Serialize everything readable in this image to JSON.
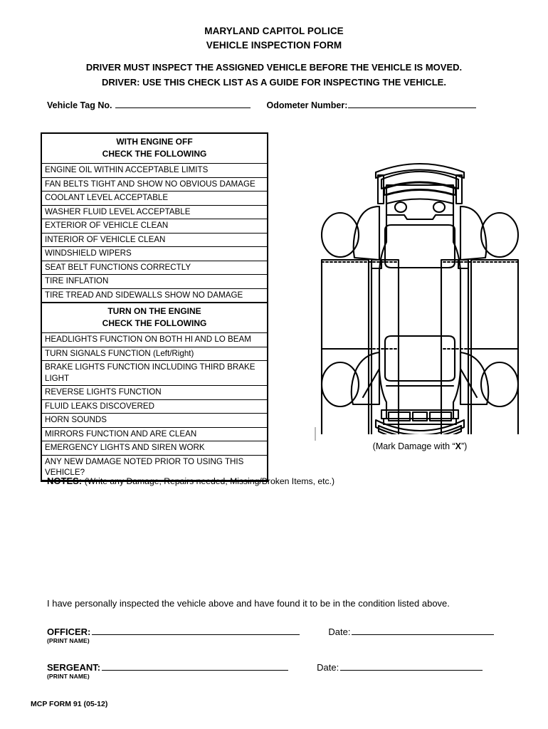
{
  "document": {
    "title_lines": [
      "MARYLAND CAPITOL POLICE",
      "VEHICLE INSPECTION FORM"
    ],
    "instructions": [
      "DRIVER MUST INSPECT THE ASSIGNED VEHICLE BEFORE THE VEHICLE IS MOVED.",
      "DRIVER: USE THIS CHECK LIST AS A GUIDE FOR INSPECTING THE VEHICLE."
    ],
    "form_number": "MCP FORM 91 (05-12)"
  },
  "identity": {
    "vehicle_tag_label": "Vehicle Tag No.",
    "vehicle_tag_value": "",
    "odometer_label": "Odometer Number:",
    "odometer_value": ""
  },
  "checklist": {
    "sections": [
      {
        "heading_line1": "WITH ENGINE OFF",
        "heading_line2": "CHECK THE FOLLOWING",
        "items": [
          "ENGINE OIL WITHIN ACCEPTABLE LIMITS",
          "FAN BELTS TIGHT AND SHOW NO OBVIOUS DAMAGE",
          "COOLANT LEVEL ACCEPTABLE",
          "WASHER FLUID LEVEL ACCEPTABLE",
          "EXTERIOR OF VEHICLE CLEAN",
          "INTERIOR OF VEHICLE CLEAN",
          "WINDSHIELD WIPERS",
          "SEAT BELT FUNCTIONS CORRECTLY",
          "TIRE INFLATION",
          "TIRE TREAD AND SIDEWALLS SHOW NO DAMAGE"
        ]
      },
      {
        "heading_line1": "TURN ON THE ENGINE",
        "heading_line2": "CHECK THE FOLLOWING",
        "items": [
          "HEADLIGHTS FUNCTION ON BOTH HI AND LO BEAM",
          "TURN SIGNALS FUNCTION (Left/Right)",
          "BRAKE LIGHTS FUNCTION INCLUDING THIRD BRAKE LIGHT",
          "REVERSE LIGHTS FUNCTION",
          "FLUID LEAKS DISCOVERED",
          "HORN SOUNDS",
          "MIRRORS FUNCTION AND ARE CLEAN",
          "EMERGENCY LIGHTS AND SIREN WORK",
          "ANY NEW DAMAGE NOTED PRIOR TO USING THIS VEHICLE?"
        ]
      }
    ]
  },
  "diagram": {
    "icon": "car-top-view-diagram",
    "caption_prefix": "(Mark Damage with “",
    "caption_mark": "X",
    "caption_suffix": "”)"
  },
  "notes": {
    "label": "NOTES",
    "separator": ": ",
    "hint": "(Write any Damage, Repairs needed, Missing/Broken Items, etc.)",
    "value": ""
  },
  "attestation": {
    "statement": "I have personally inspected the vehicle above and have found it to be in the condition listed above."
  },
  "signatures": {
    "officer": {
      "label": "OFFICER:",
      "value": "",
      "sub_label": "(PRINT NAME)",
      "date_label": "Date:",
      "date_value": ""
    },
    "sergeant": {
      "label": "SERGEANT:",
      "value": "",
      "sub_label": "(PRINT NAME)",
      "date_label": "Date:",
      "date_value": ""
    }
  },
  "colors": {
    "ink": "#000000",
    "paper": "#ffffff",
    "caret": "#b9b9b9"
  }
}
